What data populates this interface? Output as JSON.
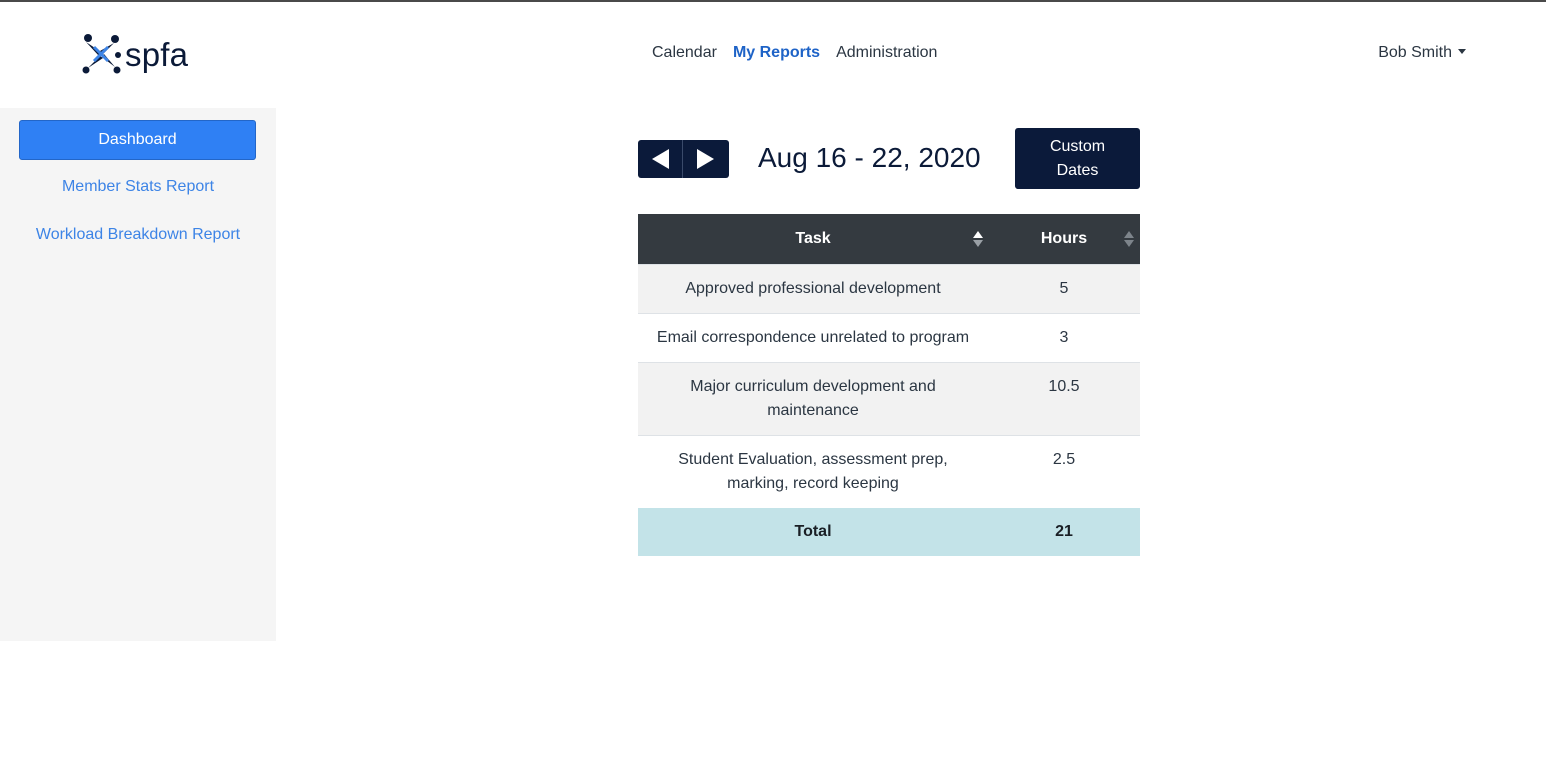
{
  "header": {
    "logo_text": "spfa",
    "nav": [
      {
        "label": "Calendar",
        "active": false
      },
      {
        "label": "My Reports",
        "active": true
      },
      {
        "label": "Administration",
        "active": false
      }
    ],
    "user_name": "Bob Smith"
  },
  "sidebar": {
    "items": [
      {
        "label": "Dashboard",
        "active": true
      },
      {
        "label": "Member Stats Report",
        "active": false
      },
      {
        "label": "Workload Breakdown Report",
        "active": false
      }
    ]
  },
  "report": {
    "date_range": "Aug 16 - 22, 2020",
    "custom_dates_label": "Custom Dates",
    "table": {
      "columns": [
        "Task",
        "Hours"
      ],
      "rows": [
        {
          "task": "Approved professional development",
          "hours": "5"
        },
        {
          "task": "Email correspondence unrelated to program",
          "hours": "3"
        },
        {
          "task": "Major curriculum development and maintenance",
          "hours": "10.5"
        },
        {
          "task": "Student Evaluation, assessment prep, marking, record keeping",
          "hours": "2.5"
        }
      ],
      "total_label": "Total",
      "total_value": "21"
    }
  },
  "colors": {
    "primary_button": "#2f80f4",
    "navy": "#0b1a3a",
    "active_nav": "#1e63c7",
    "table_header": "#343a40",
    "total_row": "#c3e3e8"
  }
}
